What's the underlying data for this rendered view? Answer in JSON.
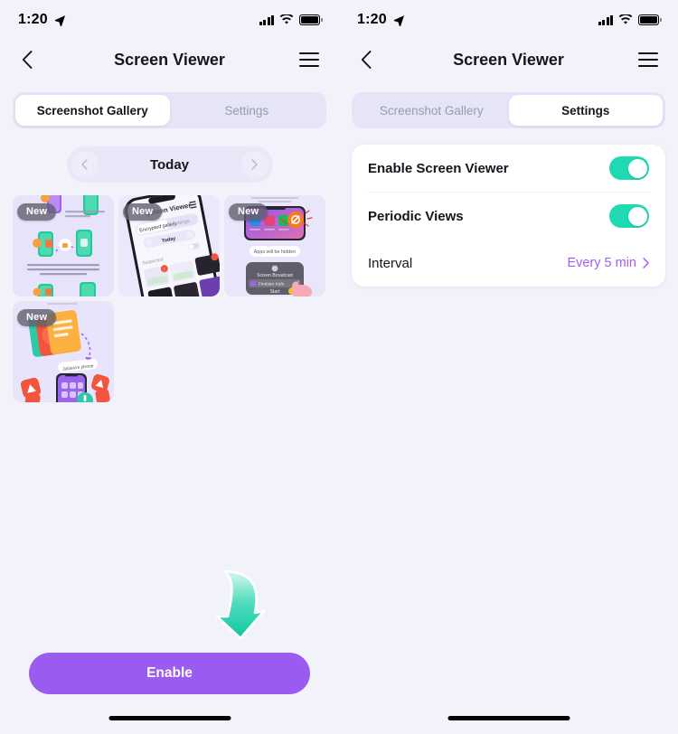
{
  "theme": {
    "background": "#f2f2fb",
    "accent_purple": "#9a5cf0",
    "toggle_green": "#1fd9b2",
    "tab_track": "#e6e5f7",
    "card_white": "#ffffff",
    "thumb_bg": "#e6e2f9"
  },
  "status_bar": {
    "time": "1:20",
    "location_icon": "location-arrow-icon",
    "signal_icon": "cellular-signal-icon",
    "wifi_icon": "wifi-icon",
    "battery_icon": "battery-full-icon"
  },
  "nav": {
    "back_icon": "chevron-left-icon",
    "title": "Screen Viewer",
    "menu_icon": "hamburger-menu-icon"
  },
  "left_panel": {
    "tabs": [
      {
        "label": "Screenshot Gallery",
        "active": true
      },
      {
        "label": "Settings",
        "active": false
      }
    ],
    "date_pager": {
      "prev_icon": "chevron-left-icon",
      "label": "Today",
      "next_icon": "chevron-right-icon"
    },
    "gallery": {
      "badge_label": "New",
      "items": [
        {
          "name": "screenshot-thumb-1",
          "badge": "New",
          "art": "encryption-explainer"
        },
        {
          "name": "screenshot-thumb-2",
          "badge": "New",
          "art": "phone-gallery-tilted"
        },
        {
          "name": "screenshot-thumb-3",
          "badge": "New",
          "art": "broadcast-permission"
        },
        {
          "name": "screenshot-thumb-4",
          "badge": "New",
          "art": "childs-phone-alerts"
        }
      ]
    },
    "cta": {
      "arrow_icon": "curved-down-arrow-icon",
      "button_label": "Enable"
    }
  },
  "right_panel": {
    "tabs": [
      {
        "label": "Screenshot Gallery",
        "active": false
      },
      {
        "label": "Settings",
        "active": true
      }
    ],
    "settings": {
      "rows": [
        {
          "label": "Enable Screen Viewer",
          "control": "toggle",
          "state": "on"
        },
        {
          "label": "Periodic Views",
          "control": "toggle",
          "state": "on"
        },
        {
          "label": "Interval",
          "control": "value",
          "value": "Every 5 min",
          "chevron": "chevron-right-icon"
        }
      ]
    }
  },
  "home_indicator": "home-indicator-bar"
}
